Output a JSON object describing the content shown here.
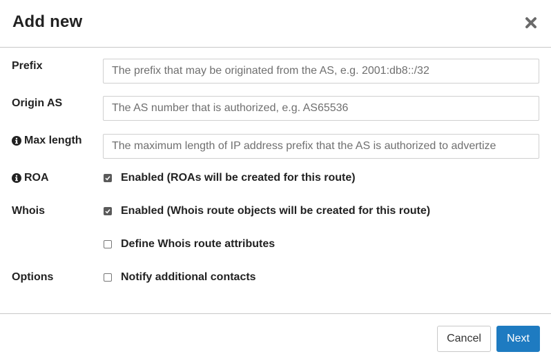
{
  "dialog": {
    "title": "Add new"
  },
  "fields": {
    "prefix": {
      "label": "Prefix",
      "value": "",
      "placeholder": "The prefix that may be originated from the AS, e.g. 2001:db8::/32"
    },
    "origin_as": {
      "label": "Origin AS",
      "value": "",
      "placeholder": "The AS number that is authorized, e.g. AS65536"
    },
    "max_length": {
      "label": "Max length",
      "value": "",
      "placeholder": "The maximum length of IP address prefix that the AS is authorized to advertize"
    }
  },
  "roa": {
    "label": "ROA",
    "checkbox_label": "Enabled (ROAs will be created for this route)",
    "checked": true
  },
  "whois": {
    "label": "Whois",
    "checkbox_label": "Enabled (Whois route objects will be created for this route)",
    "checked": true,
    "define_attributes_label": "Define Whois route attributes",
    "define_attributes_checked": false
  },
  "options": {
    "label": "Options",
    "notify_label": "Notify additional contacts",
    "notify_checked": false
  },
  "footer": {
    "cancel_label": "Cancel",
    "next_label": "Next"
  },
  "colors": {
    "primary": "#1e7bc1",
    "checkbox_checked": "#5a5a5a",
    "close_icon": "#6b6b6b"
  },
  "icons": {
    "close": "close-icon",
    "info": "info-icon",
    "check": "checkmark-icon"
  }
}
